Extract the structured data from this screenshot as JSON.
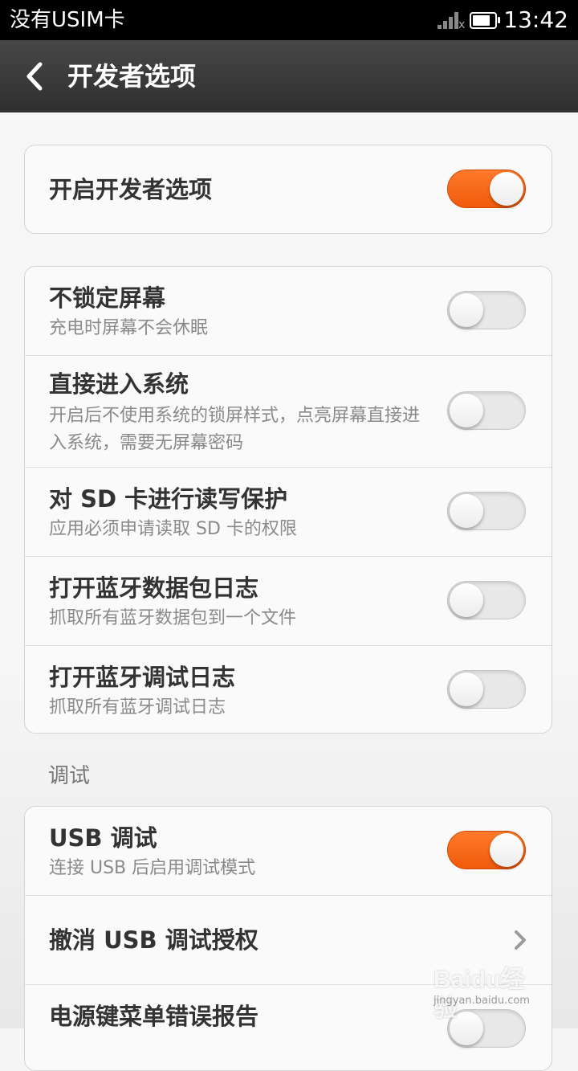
{
  "status_bar": {
    "carrier": "没有USIM卡",
    "time": "13:42",
    "battery_level": 0.7
  },
  "header": {
    "title": "开发者选项",
    "back_icon": "back-arrow-icon"
  },
  "master_toggle": {
    "title": "开启开发者选项",
    "checked": true
  },
  "group1": [
    {
      "title": "不锁定屏幕",
      "subtitle": "充电时屏幕不会休眠",
      "checked": false
    },
    {
      "title": "直接进入系统",
      "subtitle": "开启后不使用系统的锁屏样式，点亮屏幕直接进入系统，需要无屏幕密码",
      "checked": false
    },
    {
      "title": "对 SD 卡进行读写保护",
      "subtitle": "应用必须申请读取 SD 卡的权限",
      "checked": false
    },
    {
      "title": "打开蓝牙数据包日志",
      "subtitle": "抓取所有蓝牙数据包到一个文件",
      "checked": false
    },
    {
      "title": "打开蓝牙调试日志",
      "subtitle": "抓取所有蓝牙调试日志",
      "checked": false
    }
  ],
  "debug_section": {
    "header": "调试",
    "items": [
      {
        "title": "USB 调试",
        "subtitle": "连接 USB 后启用调试模式",
        "checked": true
      },
      {
        "title": "撤消 USB 调试授权",
        "chevron_icon": "chevron-right-icon"
      },
      {
        "title": "电源键菜单错误报告",
        "checked": false
      }
    ]
  },
  "watermark": {
    "logo": "Baidu经验",
    "url": "jingyan.baidu.com"
  },
  "colors": {
    "accent": "#f26318",
    "title_bar": "#3a3a3a",
    "status_bar": "#000000"
  }
}
